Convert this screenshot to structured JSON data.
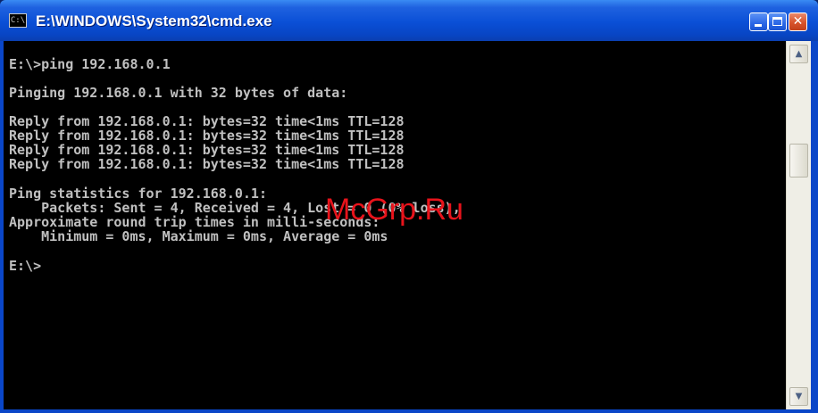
{
  "window": {
    "title": "E:\\WINDOWS\\System32\\cmd.exe",
    "icon": "console-icon",
    "icon_glyph": "C:\\",
    "controls": {
      "minimize": "minimize-icon",
      "maximize": "maximize-icon",
      "close": "close-icon",
      "close_glyph": "✕"
    }
  },
  "console": {
    "lines": [
      "E:\\>ping 192.168.0.1",
      "Pinging 192.168.0.1 with 32 bytes of data:",
      "Reply from 192.168.0.1: bytes=32 time<1ms TTL=128",
      "Reply from 192.168.0.1: bytes=32 time<1ms TTL=128",
      "Reply from 192.168.0.1: bytes=32 time<1ms TTL=128",
      "Reply from 192.168.0.1: bytes=32 time<1ms TTL=128",
      "Ping statistics for 192.168.0.1:",
      "    Packets: Sent = 4, Received = 4, Lost = 0 (0% loss),",
      "Approximate round trip times in milli-seconds:",
      "    Minimum = 0ms, Maximum = 0ms, Average = 0ms",
      "E:\\>"
    ]
  },
  "watermark": "McGrp.Ru",
  "scrollbar": {
    "up_arrow": "▲",
    "down_arrow": "▼"
  },
  "colors": {
    "titlebar": "#0a4fd6",
    "console_bg": "#000000",
    "console_text": "#c0c0c0",
    "watermark": "#e8131b",
    "close_button": "#d8532b"
  }
}
